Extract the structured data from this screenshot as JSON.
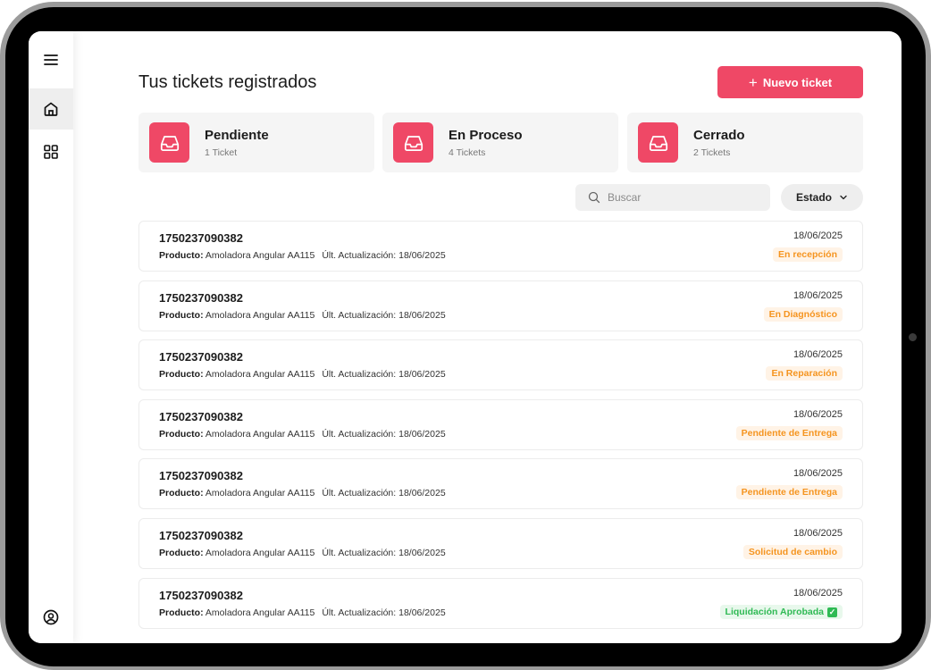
{
  "header": {
    "title": "Tus tickets registrados",
    "new_ticket_label": "Nuevo ticket",
    "new_ticket_icon": "+"
  },
  "stats": [
    {
      "title": "Pendiente",
      "count": "1 Ticket",
      "icon": "inbox-icon"
    },
    {
      "title": "En Proceso",
      "count": "4 Tickets",
      "icon": "inbox-icon"
    },
    {
      "title": "Cerrado",
      "count": "2 Tickets",
      "icon": "inbox-icon"
    }
  ],
  "filters": {
    "search_placeholder": "Buscar",
    "estado_label": "Estado"
  },
  "product_label": "Producto:",
  "tickets": [
    {
      "id": "1750237090382",
      "product": "Amoladora Angular AA115",
      "updated": "Últ. Actualización: 18/06/2025",
      "date": "18/06/2025",
      "status": "En recepción",
      "status_color": "orange"
    },
    {
      "id": "1750237090382",
      "product": "Amoladora Angular AA115",
      "updated": "Últ. Actualización: 18/06/2025",
      "date": "18/06/2025",
      "status": "En Diagnóstico",
      "status_color": "orange"
    },
    {
      "id": "1750237090382",
      "product": "Amoladora Angular AA115",
      "updated": "Últ. Actualización: 18/06/2025",
      "date": "18/06/2025",
      "status": "En Reparación",
      "status_color": "orange"
    },
    {
      "id": "1750237090382",
      "product": "Amoladora Angular AA115",
      "updated": "Últ. Actualización: 18/06/2025",
      "date": "18/06/2025",
      "status": "Pendiente de Entrega",
      "status_color": "orange"
    },
    {
      "id": "1750237090382",
      "product": "Amoladora Angular AA115",
      "updated": "Últ. Actualización: 18/06/2025",
      "date": "18/06/2025",
      "status": "Pendiente de Entrega",
      "status_color": "orange"
    },
    {
      "id": "1750237090382",
      "product": "Amoladora Angular AA115",
      "updated": "Últ. Actualización: 18/06/2025",
      "date": "18/06/2025",
      "status": "Solicitud de cambio",
      "status_color": "orange"
    },
    {
      "id": "1750237090382",
      "product": "Amoladora Angular AA115",
      "updated": "Últ. Actualización: 18/06/2025",
      "date": "18/06/2025",
      "status": "Liquidación Aprobada",
      "status_color": "green",
      "status_check": "✓"
    }
  ],
  "colors": {
    "accent": "#ef4866",
    "status_orange": "#f5941f",
    "status_green": "#2fba54"
  }
}
